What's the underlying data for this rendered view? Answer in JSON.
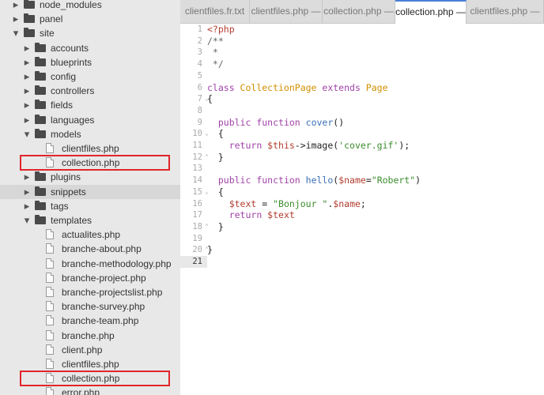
{
  "sidebar": {
    "items": [
      {
        "label": "node_modules",
        "type": "folder",
        "expanded": false,
        "depth": 1
      },
      {
        "label": "panel",
        "type": "folder",
        "expanded": false,
        "depth": 1
      },
      {
        "label": "site",
        "type": "folder",
        "expanded": true,
        "depth": 1
      },
      {
        "label": "accounts",
        "type": "folder",
        "expanded": false,
        "depth": 2
      },
      {
        "label": "blueprints",
        "type": "folder",
        "expanded": false,
        "depth": 2
      },
      {
        "label": "config",
        "type": "folder",
        "expanded": false,
        "depth": 2
      },
      {
        "label": "controllers",
        "type": "folder",
        "expanded": false,
        "depth": 2
      },
      {
        "label": "fields",
        "type": "folder",
        "expanded": false,
        "depth": 2
      },
      {
        "label": "languages",
        "type": "folder",
        "expanded": false,
        "depth": 2
      },
      {
        "label": "models",
        "type": "folder",
        "expanded": true,
        "depth": 2
      },
      {
        "label": "clientfiles.php",
        "type": "file",
        "depth": 3
      },
      {
        "label": "collection.php",
        "type": "file",
        "depth": 3,
        "highlighted": true
      },
      {
        "label": "plugins",
        "type": "folder",
        "expanded": false,
        "depth": 2
      },
      {
        "label": "snippets",
        "type": "folder",
        "expanded": false,
        "depth": 2,
        "selected": true
      },
      {
        "label": "tags",
        "type": "folder",
        "expanded": false,
        "depth": 2
      },
      {
        "label": "templates",
        "type": "folder",
        "expanded": true,
        "depth": 2
      },
      {
        "label": "actualites.php",
        "type": "file",
        "depth": 3
      },
      {
        "label": "branche-about.php",
        "type": "file",
        "depth": 3
      },
      {
        "label": "branche-methodology.php",
        "type": "file",
        "depth": 3
      },
      {
        "label": "branche-project.php",
        "type": "file",
        "depth": 3
      },
      {
        "label": "branche-projectslist.php",
        "type": "file",
        "depth": 3
      },
      {
        "label": "branche-survey.php",
        "type": "file",
        "depth": 3
      },
      {
        "label": "branche-team.php",
        "type": "file",
        "depth": 3
      },
      {
        "label": "branche.php",
        "type": "file",
        "depth": 3
      },
      {
        "label": "client.php",
        "type": "file",
        "depth": 3
      },
      {
        "label": "clientfiles.php",
        "type": "file",
        "depth": 3
      },
      {
        "label": "collection.php",
        "type": "file",
        "depth": 3,
        "highlighted": true
      },
      {
        "label": "error.php",
        "type": "file",
        "depth": 3
      }
    ]
  },
  "tabs": [
    {
      "label": "clientfiles.fr.txt",
      "active": false
    },
    {
      "label": "clientfiles.php —",
      "active": false
    },
    {
      "label": "collection.php —",
      "active": false
    },
    {
      "label": "collection.php —",
      "active": true
    },
    {
      "label": "clientfiles.php —",
      "active": false
    }
  ],
  "editor": {
    "active_line": 21,
    "lines": [
      {
        "n": "1",
        "fold": "",
        "tokens": [
          [
            "tag",
            "<?php"
          ]
        ]
      },
      {
        "n": "2",
        "fold": "",
        "tokens": [
          [
            "cmt",
            "/**"
          ]
        ]
      },
      {
        "n": "3",
        "fold": "",
        "tokens": [
          [
            "cmt",
            " *"
          ]
        ]
      },
      {
        "n": "4",
        "fold": "",
        "tokens": [
          [
            "cmt",
            " */"
          ]
        ]
      },
      {
        "n": "5",
        "fold": "",
        "tokens": []
      },
      {
        "n": "6",
        "fold": "",
        "tokens": [
          [
            "kw",
            "class "
          ],
          [
            "cls",
            "CollectionPage"
          ],
          [
            "kw",
            " extends "
          ],
          [
            "cls",
            "Page"
          ]
        ]
      },
      {
        "n": "7",
        "fold": "v",
        "tokens": [
          [
            "plain",
            "{"
          ]
        ]
      },
      {
        "n": "8",
        "fold": "",
        "tokens": []
      },
      {
        "n": "9",
        "fold": "",
        "tokens": [
          [
            "plain",
            "  "
          ],
          [
            "kw",
            "public function "
          ],
          [
            "fn",
            "cover"
          ],
          [
            "plain",
            "()"
          ]
        ]
      },
      {
        "n": "10",
        "fold": "v",
        "tokens": [
          [
            "plain",
            "  {"
          ]
        ]
      },
      {
        "n": "11",
        "fold": "",
        "tokens": [
          [
            "plain",
            "    "
          ],
          [
            "kw",
            "return "
          ],
          [
            "var",
            "$this"
          ],
          [
            "plain",
            "->image("
          ],
          [
            "str",
            "'cover.gif'"
          ],
          [
            "plain",
            ");"
          ]
        ]
      },
      {
        "n": "12",
        "fold": "^",
        "tokens": [
          [
            "plain",
            "  }"
          ]
        ]
      },
      {
        "n": "13",
        "fold": "",
        "tokens": []
      },
      {
        "n": "14",
        "fold": "",
        "tokens": [
          [
            "plain",
            "  "
          ],
          [
            "kw",
            "public function "
          ],
          [
            "fn",
            "hello"
          ],
          [
            "plain",
            "("
          ],
          [
            "var",
            "$name"
          ],
          [
            "plain",
            "="
          ],
          [
            "str",
            "\"Robert\""
          ],
          [
            "plain",
            ")"
          ]
        ]
      },
      {
        "n": "15",
        "fold": "v",
        "tokens": [
          [
            "plain",
            "  {"
          ]
        ]
      },
      {
        "n": "16",
        "fold": "",
        "tokens": [
          [
            "plain",
            "    "
          ],
          [
            "var",
            "$text"
          ],
          [
            "plain",
            " = "
          ],
          [
            "str",
            "\"Bonjour \""
          ],
          [
            "plain",
            "."
          ],
          [
            "var",
            "$name"
          ],
          [
            "plain",
            ";"
          ]
        ]
      },
      {
        "n": "17",
        "fold": "",
        "tokens": [
          [
            "plain",
            "    "
          ],
          [
            "kw",
            "return "
          ],
          [
            "var",
            "$text"
          ]
        ]
      },
      {
        "n": "18",
        "fold": "^",
        "tokens": [
          [
            "plain",
            "  }"
          ]
        ]
      },
      {
        "n": "19",
        "fold": "",
        "tokens": []
      },
      {
        "n": "20",
        "fold": "^",
        "tokens": [
          [
            "plain",
            "}"
          ]
        ]
      },
      {
        "n": "21",
        "fold": "",
        "tokens": []
      }
    ]
  },
  "colors": {
    "highlight_box": "#e0262b",
    "active_tab_accent": "#4a7fd6"
  }
}
